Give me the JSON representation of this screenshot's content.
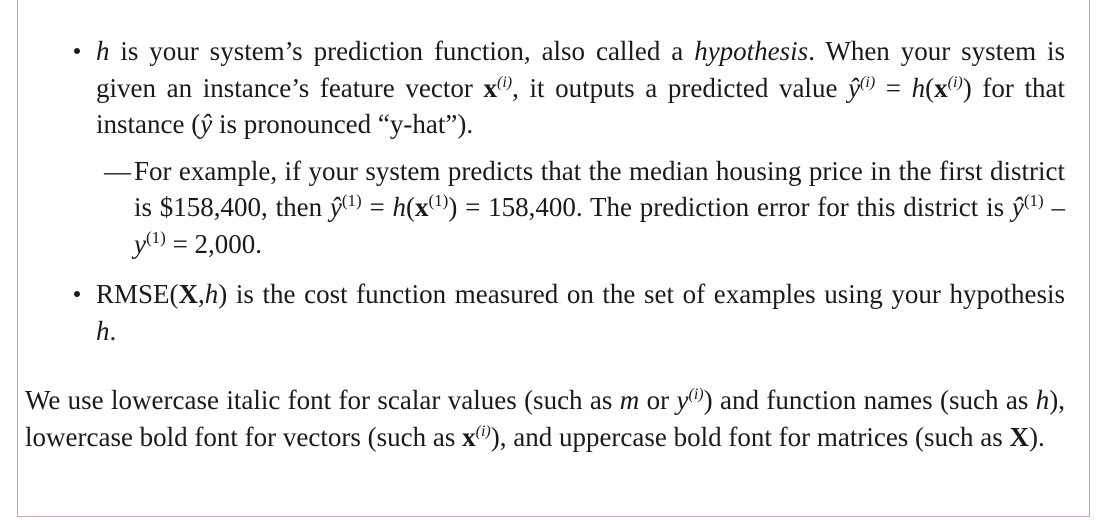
{
  "bullet1": {
    "h": "h",
    "t1": " is your system’s prediction function, also called a ",
    "hypothesis": "hypothesis",
    "t2": ". When your system is given an instance’s feature vector ",
    "x": "x",
    "sup_i": "(i)",
    "t3": ", it outputs a predicted value ",
    "yhat": "ŷ",
    "sup_i2": "(i)",
    "eq": " = ",
    "h2": "h",
    "paren_open": "(",
    "x2": "x",
    "sup_i3": "(i)",
    "paren_close": ")",
    "t4": " for that instance (",
    "yhat2": "ŷ",
    "t5": " is pronounced “y-hat”)."
  },
  "subitem": {
    "dash": "—",
    "t1": "For example, if your system predicts that the median housing price in the first district is $158,400, then ",
    "yhat": "ŷ",
    "sup1": "(1)",
    "eq1": " = ",
    "h": "h",
    "po": "(",
    "x": "x",
    "sup2": "(1)",
    "t2": ") = 158,400. The prediction error for this district is ",
    "yhat2": "ŷ",
    "sup3": "(1)",
    "minus": " – ",
    "y": "y",
    "sup4": "(1)",
    "t3": " = 2,000."
  },
  "bullet2": {
    "t1": "RMSE(",
    "X": "X",
    "comma": ",",
    "h": "h",
    "t2": ") is the cost function measured on the set of examples using your hypothesis ",
    "h2": "h",
    "t3": "."
  },
  "paragraph": {
    "t1": "We use lowercase italic font for scalar values (such as ",
    "m": "m",
    "or": " or ",
    "y": "y",
    "sup_i": "(i)",
    "t2": ") and function names (such as ",
    "h": "h",
    "t3": "), lowercase bold font for vectors (such as ",
    "x": "x",
    "sup_i2": "(i)",
    "t4": "), and uppercase bold font for matrices (such as ",
    "X": "X",
    "t5": ")."
  }
}
